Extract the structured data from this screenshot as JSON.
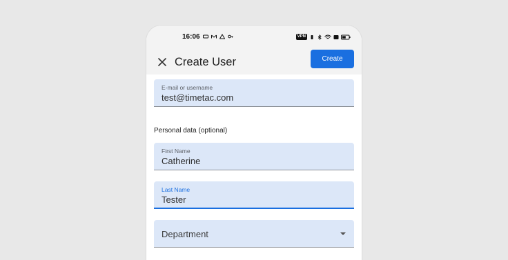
{
  "statusbar": {
    "time": "16:06",
    "vpn_label": "VPN"
  },
  "appbar": {
    "title": "Create User",
    "create_label": "Create"
  },
  "form": {
    "email": {
      "label": "E-mail or username",
      "value": "test@timetac.com"
    },
    "section_label": "Personal data (optional)",
    "first_name": {
      "label": "First Name",
      "value": "Catherine"
    },
    "last_name": {
      "label": "Last Name",
      "value": "Tester"
    },
    "department": {
      "value": "Department"
    }
  },
  "colors": {
    "accent": "#1a6fe0",
    "field_bg": "#dce7f8",
    "background": "#e8e8e8"
  }
}
